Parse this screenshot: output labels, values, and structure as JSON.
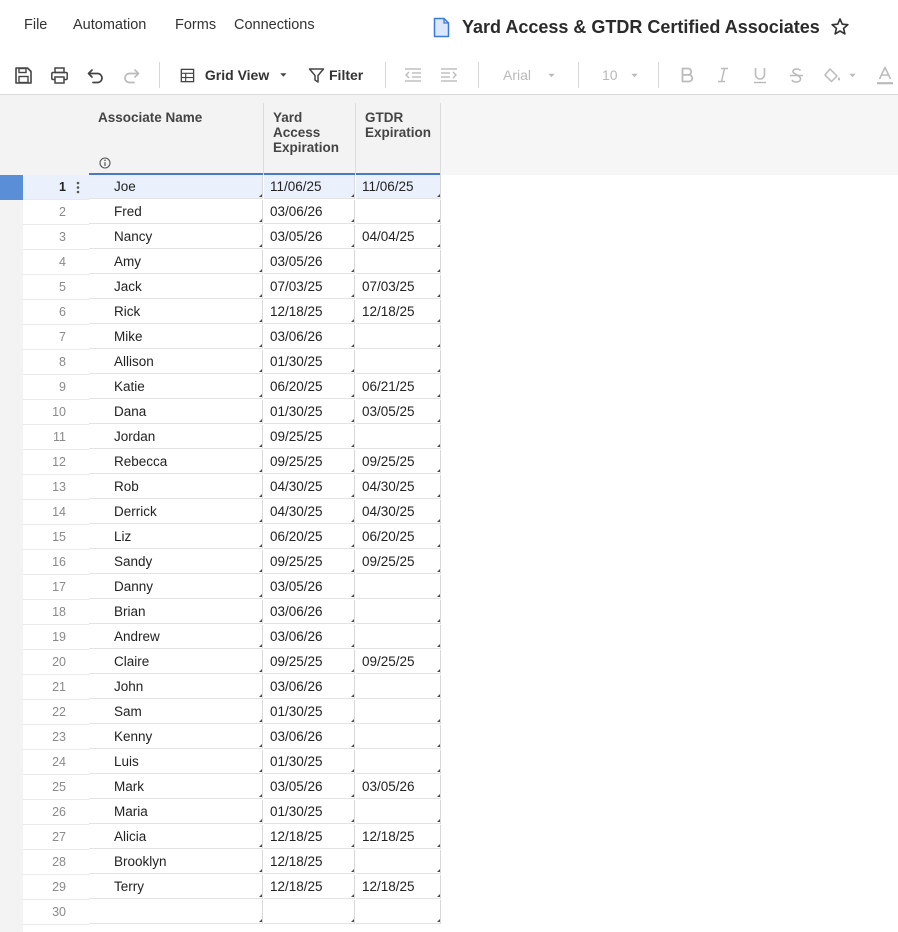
{
  "menu": {
    "file": "File",
    "automation": "Automation",
    "forms": "Forms",
    "connections": "Connections"
  },
  "sheet": {
    "title": "Yard Access & GTDR Certified Associates",
    "icon": "sheet-icon",
    "favorite_icon": "star-icon"
  },
  "toolbar": {
    "save_icon": "save-icon",
    "print_icon": "print-icon",
    "undo_icon": "undo-icon",
    "redo_icon": "redo-icon",
    "view_label": "Grid View",
    "filter_label": "Filter",
    "font_family": "Arial",
    "font_size": "10"
  },
  "columns": {
    "name": "Associate Name",
    "yard": [
      "Yard",
      "Access",
      "Expiration"
    ],
    "gtdr": [
      "GTDR",
      "Expiration"
    ]
  },
  "colors": {
    "accent": "#4a78c4",
    "selected_row": "#eaf1fc",
    "row_handle": "#5a8ed6"
  },
  "rows": [
    {
      "num": "1",
      "name": "Joe",
      "yard": "11/06/25",
      "gtdr": "11/06/25"
    },
    {
      "num": "2",
      "name": "Fred",
      "yard": "03/06/26",
      "gtdr": ""
    },
    {
      "num": "3",
      "name": "Nancy",
      "yard": "03/05/26",
      "gtdr": "04/04/25"
    },
    {
      "num": "4",
      "name": "Amy",
      "yard": "03/05/26",
      "gtdr": ""
    },
    {
      "num": "5",
      "name": "Jack",
      "yard": "07/03/25",
      "gtdr": "07/03/25"
    },
    {
      "num": "6",
      "name": "Rick",
      "yard": "12/18/25",
      "gtdr": "12/18/25"
    },
    {
      "num": "7",
      "name": "Mike",
      "yard": "03/06/26",
      "gtdr": ""
    },
    {
      "num": "8",
      "name": "Allison",
      "yard": "01/30/25",
      "gtdr": ""
    },
    {
      "num": "9",
      "name": "Katie",
      "yard": "06/20/25",
      "gtdr": "06/21/25"
    },
    {
      "num": "10",
      "name": "Dana",
      "yard": "01/30/25",
      "gtdr": "03/05/25"
    },
    {
      "num": "11",
      "name": "Jordan",
      "yard": "09/25/25",
      "gtdr": ""
    },
    {
      "num": "12",
      "name": "Rebecca",
      "yard": "09/25/25",
      "gtdr": "09/25/25"
    },
    {
      "num": "13",
      "name": "Rob",
      "yard": "04/30/25",
      "gtdr": "04/30/25"
    },
    {
      "num": "14",
      "name": "Derrick",
      "yard": "04/30/25",
      "gtdr": "04/30/25"
    },
    {
      "num": "15",
      "name": "Liz",
      "yard": "06/20/25",
      "gtdr": "06/20/25"
    },
    {
      "num": "16",
      "name": "Sandy",
      "yard": "09/25/25",
      "gtdr": "09/25/25"
    },
    {
      "num": "17",
      "name": "Danny",
      "yard": "03/05/26",
      "gtdr": ""
    },
    {
      "num": "18",
      "name": "Brian",
      "yard": "03/06/26",
      "gtdr": ""
    },
    {
      "num": "19",
      "name": "Andrew",
      "yard": "03/06/26",
      "gtdr": ""
    },
    {
      "num": "20",
      "name": "Claire",
      "yard": "09/25/25",
      "gtdr": "09/25/25"
    },
    {
      "num": "21",
      "name": "John",
      "yard": "03/06/26",
      "gtdr": ""
    },
    {
      "num": "22",
      "name": "Sam",
      "yard": "01/30/25",
      "gtdr": ""
    },
    {
      "num": "23",
      "name": "Kenny",
      "yard": "03/06/26",
      "gtdr": ""
    },
    {
      "num": "24",
      "name": "Luis",
      "yard": "01/30/25",
      "gtdr": ""
    },
    {
      "num": "25",
      "name": "Mark",
      "yard": "03/05/26",
      "gtdr": "03/05/26"
    },
    {
      "num": "26",
      "name": "Maria",
      "yard": "01/30/25",
      "gtdr": ""
    },
    {
      "num": "27",
      "name": "Alicia",
      "yard": "12/18/25",
      "gtdr": "12/18/25"
    },
    {
      "num": "28",
      "name": "Brooklyn",
      "yard": "12/18/25",
      "gtdr": ""
    },
    {
      "num": "29",
      "name": "Terry",
      "yard": "12/18/25",
      "gtdr": "12/18/25"
    },
    {
      "num": "30",
      "name": "",
      "yard": "",
      "gtdr": ""
    }
  ]
}
